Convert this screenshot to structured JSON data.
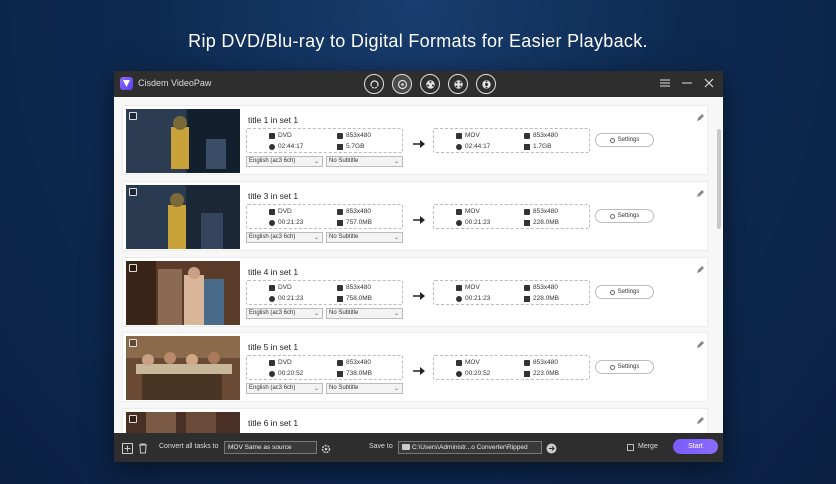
{
  "headline": "Rip DVD/Blu-ray to Digital Formats for Easier Playback.",
  "app": {
    "name": "Cisdem VideoPaw"
  },
  "toolbar": {
    "icons": [
      "converter-icon",
      "ripper-icon",
      "reel-icon",
      "film-reel-icon",
      "disc-reel-icon"
    ]
  },
  "items": [
    {
      "title": "title 1 in set 1",
      "src_format": "DVD",
      "src_res": "853x480",
      "src_duration": "02:44:17",
      "src_size": "5.7GB",
      "dst_format": "MOV",
      "dst_res": "853x480",
      "dst_duration": "02:44:17",
      "dst_size": "1.7GB",
      "audio": "English (ac3 6ch)",
      "subtitle": "No Subtitle",
      "settings": "Settings"
    },
    {
      "title": "title 3 in set 1",
      "src_format": "DVD",
      "src_res": "853x480",
      "src_duration": "00:21:23",
      "src_size": "757.0MB",
      "dst_format": "MOV",
      "dst_res": "853x480",
      "dst_duration": "00:21:23",
      "dst_size": "228.0MB",
      "audio": "English (ac3 6ch)",
      "subtitle": "No Subtitle",
      "settings": "Settings"
    },
    {
      "title": "title 4 in set 1",
      "src_format": "DVD",
      "src_res": "853x480",
      "src_duration": "00:21:23",
      "src_size": "758.0MB",
      "dst_format": "MOV",
      "dst_res": "853x480",
      "dst_duration": "00:21:23",
      "dst_size": "228.0MB",
      "audio": "English (ac3 6ch)",
      "subtitle": "No Subtitle",
      "settings": "Settings"
    },
    {
      "title": "title 5 in set 1",
      "src_format": "DVD",
      "src_res": "853x480",
      "src_duration": "00:20:52",
      "src_size": "738.0MB",
      "dst_format": "MOV",
      "dst_res": "853x480",
      "dst_duration": "00:20:52",
      "dst_size": "223.0MB",
      "audio": "English (ac3 6ch)",
      "subtitle": "No Subtitle",
      "settings": "Settings"
    },
    {
      "title": "title 6 in set 1"
    }
  ],
  "bottom": {
    "convert_label": "Convert all tasks to",
    "convert_value": "MOV Same as source",
    "save_label": "Save to",
    "save_path": "C:\\Users\\Administr...o Converter\\Ripped",
    "merge_label": "Merge",
    "start_label": "Start"
  }
}
